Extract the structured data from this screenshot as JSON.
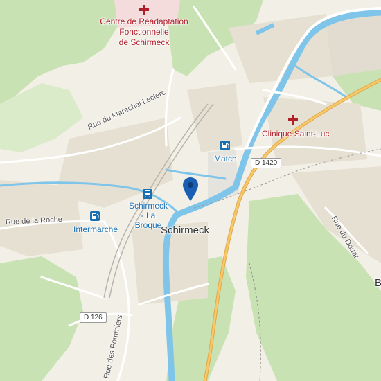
{
  "pois": {
    "hospital_center": {
      "label": "Centre de Réadaptation\nFonctionnelle\nde Schirmeck",
      "icon": "hospital-cross-icon"
    },
    "clinique": {
      "label": "Clinique Saint-Luc",
      "icon": "hospital-cross-icon"
    },
    "match": {
      "label": "Match",
      "icon": "fuel-pump-icon"
    },
    "intermarche": {
      "label": "Intermarché",
      "icon": "fuel-pump-icon"
    },
    "station": {
      "label": "Schirmeck\n- La Broque",
      "icon": "train-station-icon"
    }
  },
  "town": {
    "name": "Schirmeck",
    "partial_label": "B"
  },
  "streets": {
    "marechal_leclerc": "Rue du Maréchal Leclerc",
    "roche": "Rue de la Roche",
    "pommiers": "Rue des Pommiers",
    "douar": "Rue du Douar"
  },
  "road_shields": {
    "d1420": "D 1420",
    "d126": "D 126"
  },
  "colors": {
    "background": "#f2efe6",
    "forest": "#c9e2b3",
    "water": "#7fc5ea",
    "main_road": "#f7c769",
    "poi_red": "#b0202a",
    "poi_blue": "#1a6fb0",
    "marker": "#1a5fb4"
  },
  "marker": {
    "icon": "location-pin-icon"
  }
}
